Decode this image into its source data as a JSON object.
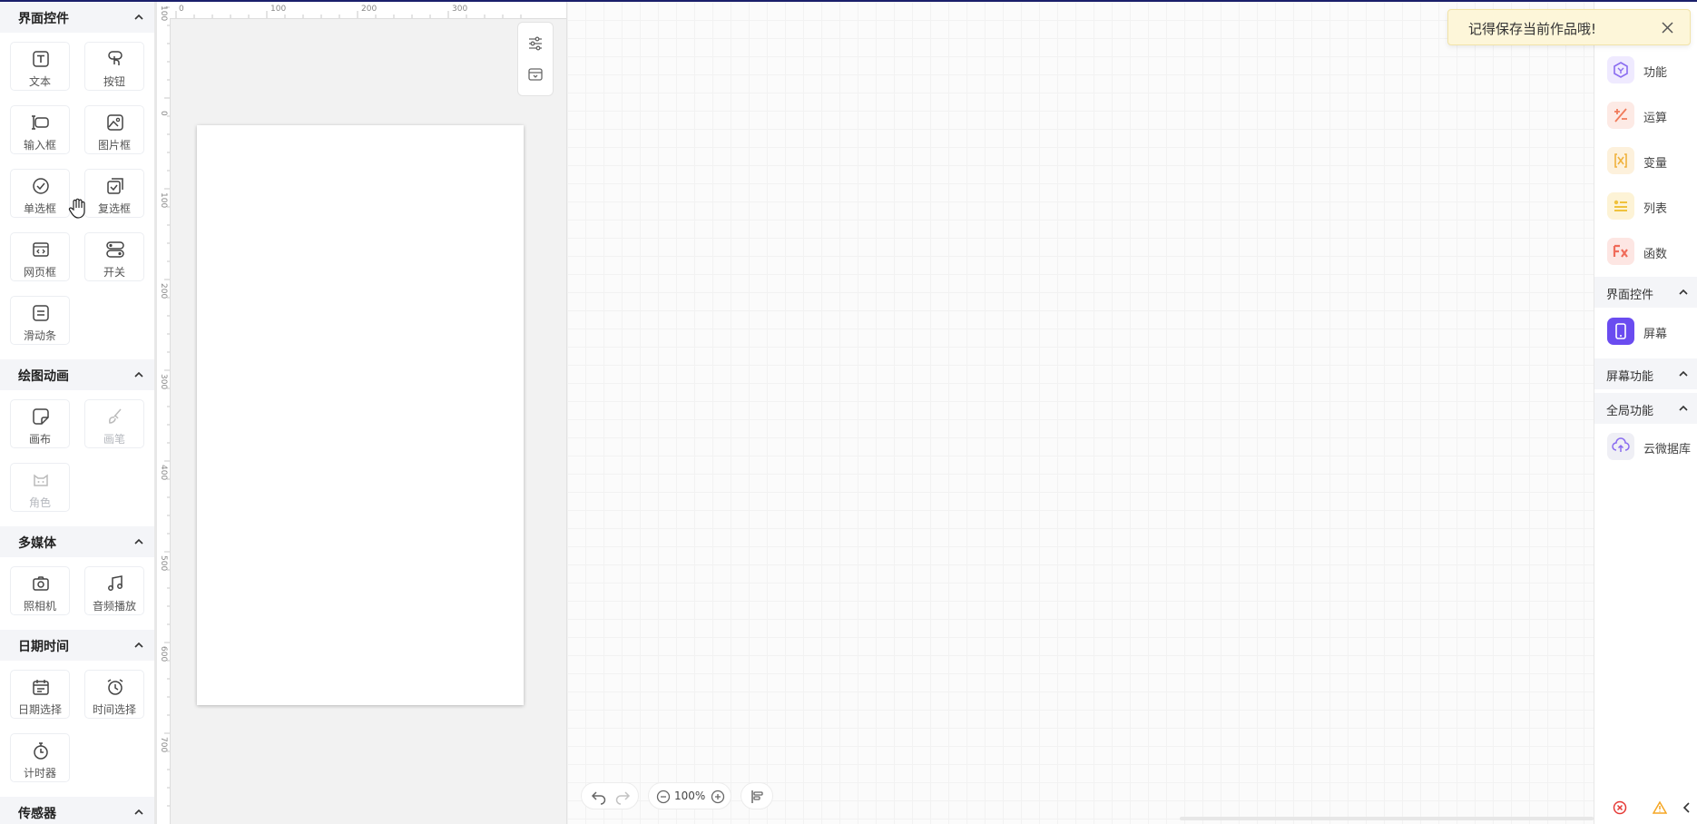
{
  "left": {
    "sections": [
      {
        "title": "界面控件",
        "items": [
          "文本",
          "按钮",
          "输入框",
          "图片框",
          "单选框",
          "复选框",
          "网页框",
          "开关",
          "滑动条"
        ]
      },
      {
        "title": "绘图动画",
        "items": [
          "画布",
          "画笔",
          "角色"
        ]
      },
      {
        "title": "多媒体",
        "items": [
          "照相机",
          "音频播放"
        ]
      },
      {
        "title": "日期时间",
        "items": [
          "日期选择",
          "时间选择",
          "计时器"
        ]
      },
      {
        "title": "传感器",
        "items": []
      }
    ]
  },
  "ruler": {
    "h": [
      "0",
      "100",
      "200",
      "300"
    ],
    "v": [
      "100",
      "0",
      "100",
      "200",
      "300",
      "400",
      "500",
      "600",
      "700"
    ]
  },
  "bottombar": {
    "zoom": "100%"
  },
  "right": {
    "items": [
      "功能",
      "运算",
      "变量",
      "列表",
      "函数"
    ],
    "sections": [
      {
        "title": "界面控件",
        "items": [
          "屏幕"
        ]
      },
      {
        "title": "屏幕功能",
        "items": []
      },
      {
        "title": "全局功能",
        "items": [
          "云微据库"
        ]
      }
    ]
  },
  "toast": {
    "message": "记得保存当前作品哦!"
  },
  "colors": {
    "accent": "#6a4cf0",
    "toast_bg": "#fdf6d9",
    "func": "#8a6cf0",
    "calc": "#f07a5a",
    "var": "#f0b23c",
    "list": "#f0c23c",
    "fn": "#f06b5a",
    "error": "#e53935",
    "warn": "#f5a623"
  }
}
